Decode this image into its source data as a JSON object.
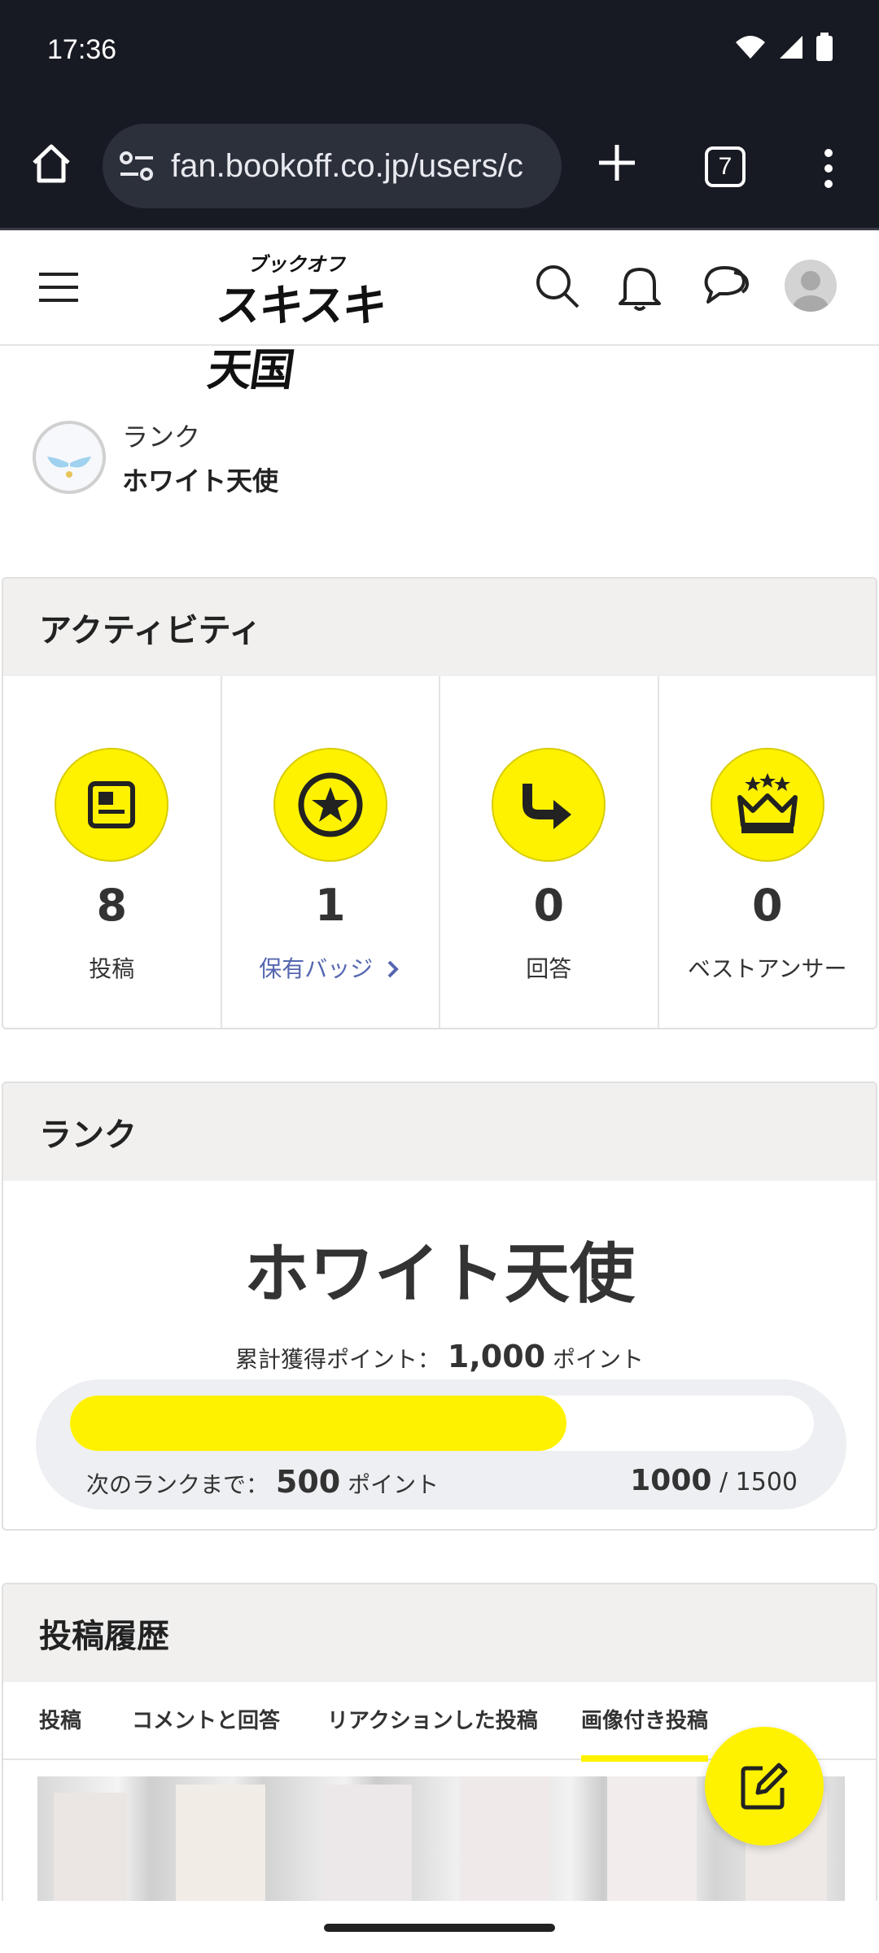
{
  "status_bar": {
    "time": "17:36"
  },
  "browser": {
    "url": "fan.bookoff.co.jp/users/c",
    "tab_count": "7"
  },
  "site": {
    "logo_small": "ブックオフ",
    "logo_big": "スキスキ天国"
  },
  "rank_summary": {
    "label": "ランク",
    "name": "ホワイト天使",
    "emblem_text": "ホワイト天使"
  },
  "activity": {
    "title": "アクティビティ",
    "items": [
      {
        "icon": "post-icon",
        "count": "8",
        "label": "投稿"
      },
      {
        "icon": "badge-star-icon",
        "count": "1",
        "label": "保有バッジ"
      },
      {
        "icon": "reply-arrow-icon",
        "count": "0",
        "label": "回答"
      },
      {
        "icon": "crown-icon",
        "count": "0",
        "label": "ベストアンサー"
      }
    ]
  },
  "rank": {
    "title": "ランク",
    "name": "ホワイト天使",
    "total_label": "累計獲得ポイント：",
    "total_value": "1,000",
    "unit": "ポイント",
    "next_label": "次のランクまで：",
    "next_value": "500",
    "progress_current": "1000",
    "progress_max": "1500",
    "progress_fraction": 0.667
  },
  "history": {
    "title": "投稿履歴",
    "tabs": [
      "投稿",
      "コメントと回答",
      "リアクションした投稿",
      "画像付き投稿"
    ],
    "active_tab": 3
  },
  "colors": {
    "accent": "#fff200",
    "link": "#5566b0",
    "card_header": "#f1f0ef",
    "browser_bg": "#181a23"
  }
}
